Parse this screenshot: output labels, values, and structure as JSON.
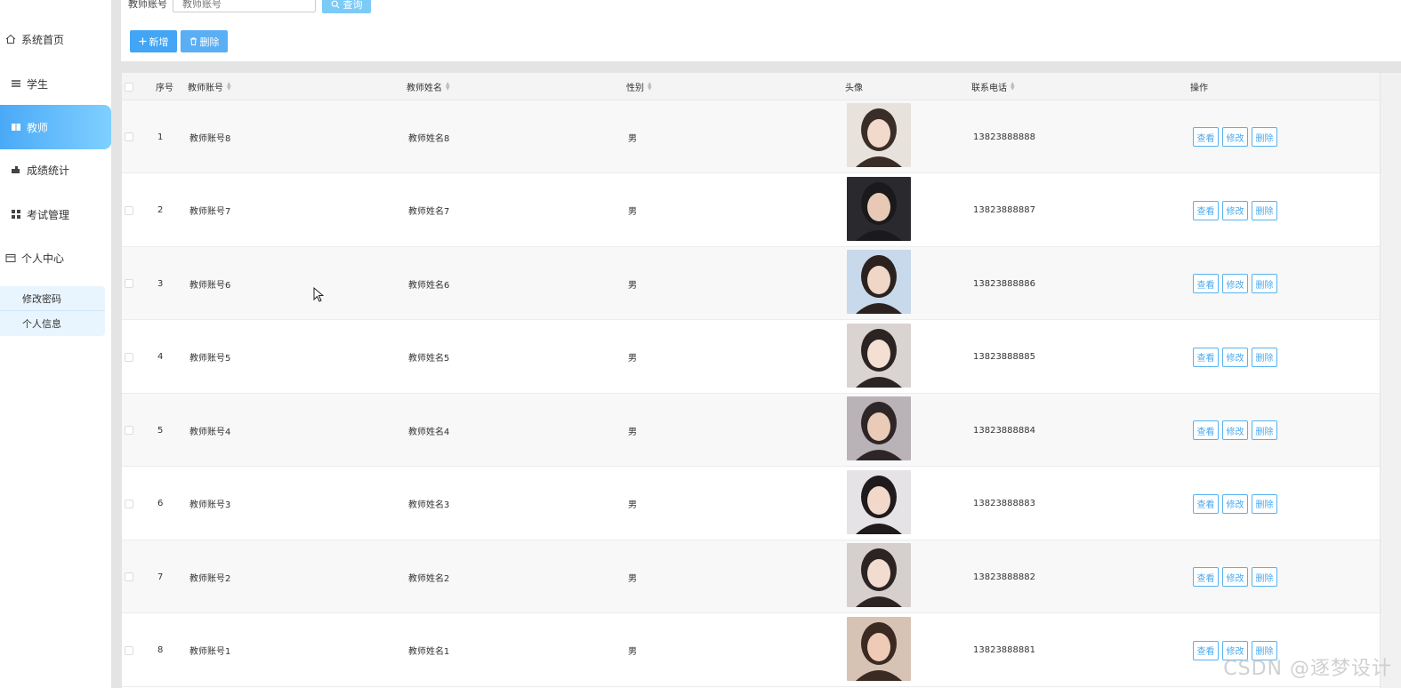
{
  "sidebar": {
    "items": [
      {
        "label": "系统首页",
        "icon": "home-icon"
      },
      {
        "label": "学生",
        "icon": "list-icon"
      },
      {
        "label": "教师",
        "icon": "book-icon"
      },
      {
        "label": "成绩统计",
        "icon": "chart-icon"
      },
      {
        "label": "考试管理",
        "icon": "grid-icon"
      },
      {
        "label": "个人中心",
        "icon": "folder-icon"
      }
    ],
    "active": "教师",
    "submenu": [
      {
        "label": "修改密码"
      },
      {
        "label": "个人信息"
      }
    ]
  },
  "search": {
    "label": "教师账号",
    "placeholder": "教师账号",
    "query_label": "查询"
  },
  "toolbar": {
    "add_label": "新增",
    "delete_label": "删除"
  },
  "table": {
    "headers": {
      "index": "序号",
      "account": "教师账号",
      "name": "教师姓名",
      "gender": "性别",
      "avatar": "头像",
      "phone": "联系电话",
      "actions": "操作"
    },
    "rows": [
      {
        "index": "1",
        "account": "教师账号8",
        "name": "教师姓名8",
        "gender": "男",
        "phone": "13823888888"
      },
      {
        "index": "2",
        "account": "教师账号7",
        "name": "教师姓名7",
        "gender": "男",
        "phone": "13823888887"
      },
      {
        "index": "3",
        "account": "教师账号6",
        "name": "教师姓名6",
        "gender": "男",
        "phone": "13823888886"
      },
      {
        "index": "4",
        "account": "教师账号5",
        "name": "教师姓名5",
        "gender": "男",
        "phone": "13823888885"
      },
      {
        "index": "5",
        "account": "教师账号4",
        "name": "教师姓名4",
        "gender": "男",
        "phone": "13823888884"
      },
      {
        "index": "6",
        "account": "教师账号3",
        "name": "教师姓名3",
        "gender": "男",
        "phone": "13823888883"
      },
      {
        "index": "7",
        "account": "教师账号2",
        "name": "教师姓名2",
        "gender": "男",
        "phone": "13823888882"
      },
      {
        "index": "8",
        "account": "教师账号1",
        "name": "教师姓名1",
        "gender": "男",
        "phone": "13823888881"
      }
    ],
    "row_actions": {
      "view": "查看",
      "edit": "修改",
      "delete": "删除"
    }
  },
  "watermark": "CSDN @逐梦设计",
  "colors": {
    "accent": "#42a5f5",
    "active_menu": "#4aa9f7",
    "op_border": "#56b3f0"
  }
}
